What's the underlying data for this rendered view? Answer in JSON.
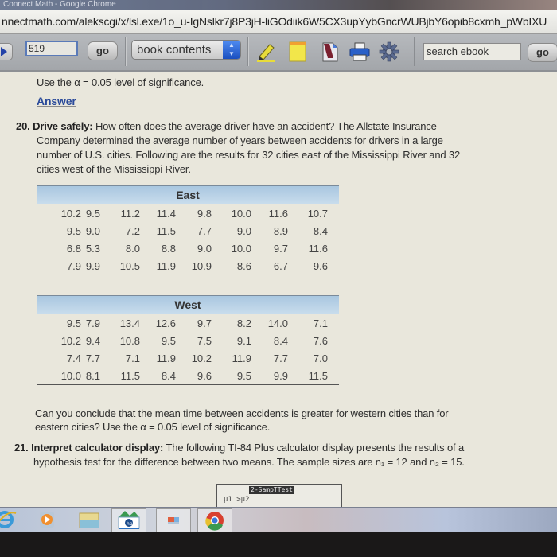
{
  "window": {
    "title": "Connect Math - Google Chrome",
    "url": "nnectmath.com/alekscgi/x/lsl.exe/1o_u-IgNslkr7j8P3jH-liGOdiik6W5CX3upYybGncrWUBjbY6opib8cxmh_pWbIXU"
  },
  "toolbar": {
    "page_number": "519",
    "go_label": "go",
    "book_select_value": "book contents",
    "icons": [
      "highlighter-icon",
      "sticky-note-icon",
      "bookmark-icon",
      "printer-icon",
      "gear-icon"
    ],
    "search_placeholder": "search ebook",
    "search_go_label": "go"
  },
  "content": {
    "prev_tail": "Use the α = 0.05 level of significance.",
    "answer_link": "Answer",
    "q20": {
      "number": "20.",
      "title": "Drive safely:",
      "lines": [
        "How often does the average driver have an accident? The Allstate Insurance",
        "Company determined the average number of years between accidents for drivers in a large",
        "number of U.S. cities. Following are the results for 32 cities east of the Mississippi River and 32",
        "cities west of the Mississippi River."
      ],
      "tables": [
        {
          "header": "East",
          "rows": [
            [
              "10.2",
              "9.5",
              "11.2",
              "11.4",
              "9.8",
              "10.0",
              "11.6",
              "10.7"
            ],
            [
              "9.5",
              "9.0",
              "7.2",
              "11.5",
              "7.7",
              "9.0",
              "8.9",
              "8.4"
            ],
            [
              "6.8",
              "5.3",
              "8.0",
              "8.8",
              "9.0",
              "10.0",
              "9.7",
              "11.6"
            ],
            [
              "7.9",
              "9.9",
              "10.5",
              "11.9",
              "10.9",
              "8.6",
              "6.7",
              "9.6"
            ]
          ]
        },
        {
          "header": "West",
          "rows": [
            [
              "9.5",
              "7.9",
              "13.4",
              "12.6",
              "9.7",
              "8.2",
              "14.0",
              "7.1"
            ],
            [
              "10.2",
              "9.4",
              "10.8",
              "9.5",
              "7.5",
              "9.1",
              "8.4",
              "7.6"
            ],
            [
              "7.4",
              "7.7",
              "7.1",
              "11.9",
              "10.2",
              "11.9",
              "7.7",
              "7.0"
            ],
            [
              "10.0",
              "8.1",
              "11.5",
              "8.4",
              "9.6",
              "9.5",
              "9.9",
              "11.5"
            ]
          ]
        }
      ],
      "question_lines": [
        "Can you conclude that the mean time between accidents is greater for western cities than for",
        "eastern cities? Use the α = 0.05 level of significance."
      ]
    },
    "q21": {
      "number": "21.",
      "title": "Interpret calculator display:",
      "lines": [
        "The following TI-84 Plus calculator display presents the results of a",
        "hypothesis test for the difference between two means. The sample sizes are n₁ = 12 and n₂ = 15."
      ],
      "calculator": {
        "title": "2-SampTTest",
        "hypothesis": "μ1 >μ2"
      }
    }
  },
  "taskbar": {
    "items": [
      "internet-explorer-icon",
      "media-player-icon",
      "file-explorer-icon",
      "hp-app-icon",
      "app-icon",
      "chrome-icon"
    ]
  }
}
